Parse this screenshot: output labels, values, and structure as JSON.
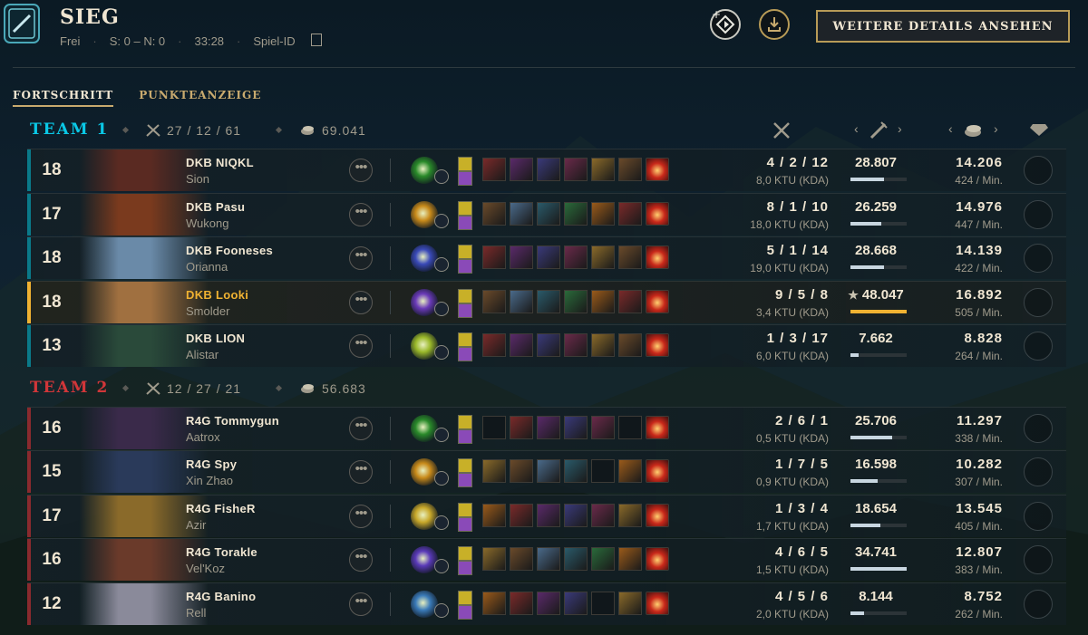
{
  "header": {
    "result": "SIEG",
    "queue": "Frei",
    "score": "S: 0 – N: 0",
    "duration": "33:28",
    "game_id_label": "Spiel-ID",
    "details_button": "WEITERE DETAILS ANSEHEN"
  },
  "tabs": [
    {
      "label": "FORTSCHRITT",
      "active": true
    },
    {
      "label": "PUNKTEANZEIGE",
      "active": false
    }
  ],
  "teams": [
    {
      "name": "TEAM 1",
      "color": "#0ac8e6",
      "kda": "27 / 12 / 61",
      "gold": "69.041",
      "players": [
        {
          "level": "18",
          "name": "DKB NIQKL",
          "champion": "Sion",
          "kda": "4 / 2 / 12",
          "kda_ratio": "8,0 KTU (KDA)",
          "damage": "28.807",
          "damage_pct": 0.6,
          "gold": "14.206",
          "gpm": "424 / Min.",
          "highlight": false
        },
        {
          "level": "17",
          "name": "DKB Pasu",
          "champion": "Wukong",
          "kda": "8 / 1 / 10",
          "kda_ratio": "18,0 KTU (KDA)",
          "damage": "26.259",
          "damage_pct": 0.55,
          "gold": "14.976",
          "gpm": "447 / Min.",
          "highlight": false
        },
        {
          "level": "18",
          "name": "DKB Fooneses",
          "champion": "Orianna",
          "kda": "5 / 1 / 14",
          "kda_ratio": "19,0 KTU (KDA)",
          "damage": "28.668",
          "damage_pct": 0.6,
          "gold": "14.139",
          "gpm": "422 / Min.",
          "highlight": false
        },
        {
          "level": "18",
          "name": "DKB Looki",
          "champion": "Smolder",
          "kda": "9 / 5 / 8",
          "kda_ratio": "3,4 KTU (KDA)",
          "damage": "48.047",
          "damage_pct": 1.0,
          "gold": "16.892",
          "gpm": "505 / Min.",
          "highlight": true,
          "star": "★"
        },
        {
          "level": "13",
          "name": "DKB LION",
          "champion": "Alistar",
          "kda": "1 / 3 / 17",
          "kda_ratio": "6,0 KTU (KDA)",
          "damage": "7.662",
          "damage_pct": 0.15,
          "gold": "8.828",
          "gpm": "264 / Min.",
          "highlight": false
        }
      ]
    },
    {
      "name": "TEAM 2",
      "color": "#d13639",
      "kda": "12 / 27 / 21",
      "gold": "56.683",
      "players": [
        {
          "level": "16",
          "name": "R4G Tommygun",
          "champion": "Aatrox",
          "kda": "2 / 6 / 1",
          "kda_ratio": "0,5 KTU (KDA)",
          "damage": "25.706",
          "damage_pct": 0.74,
          "gold": "11.297",
          "gpm": "338 / Min.",
          "highlight": false
        },
        {
          "level": "15",
          "name": "R4G Spy",
          "champion": "Xin Zhao",
          "kda": "1 / 7 / 5",
          "kda_ratio": "0,9 KTU (KDA)",
          "damage": "16.598",
          "damage_pct": 0.48,
          "gold": "10.282",
          "gpm": "307 / Min.",
          "highlight": false
        },
        {
          "level": "17",
          "name": "R4G FisheR",
          "champion": "Azir",
          "kda": "1 / 3 / 4",
          "kda_ratio": "1,7 KTU (KDA)",
          "damage": "18.654",
          "damage_pct": 0.54,
          "gold": "13.545",
          "gpm": "405 / Min.",
          "highlight": false
        },
        {
          "level": "16",
          "name": "R4G Torakle",
          "champion": "Vel'Koz",
          "kda": "4 / 6 / 5",
          "kda_ratio": "1,5 KTU (KDA)",
          "damage": "34.741",
          "damage_pct": 1.0,
          "gold": "12.807",
          "gpm": "383 / Min.",
          "highlight": false
        },
        {
          "level": "12",
          "name": "R4G Banino",
          "champion": "Rell",
          "kda": "4 / 5 / 6",
          "kda_ratio": "2,0 KTU (KDA)",
          "damage": "8.144",
          "damage_pct": 0.24,
          "gold": "8.752",
          "gpm": "262 / Min.",
          "highlight": false
        }
      ]
    }
  ],
  "colors": {
    "gold_accent": "#c8aa6e",
    "highlight": "#f0b232",
    "team1": "#0ac8e6",
    "team2": "#d13639"
  }
}
